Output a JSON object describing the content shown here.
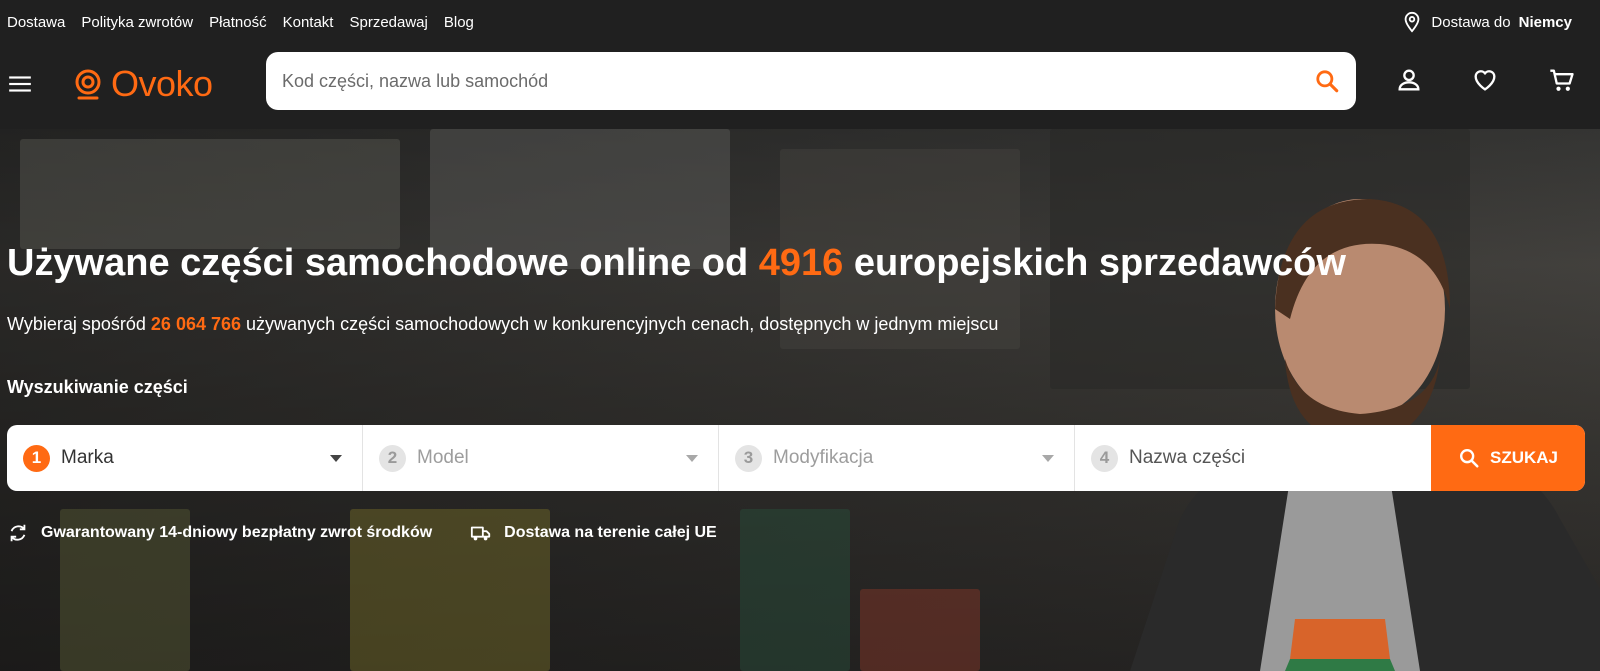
{
  "topbar": {
    "links": [
      "Dostawa",
      "Polityka zwrotów",
      "Płatność",
      "Kontakt",
      "Sprzedawaj",
      "Blog"
    ],
    "delivery_prefix": "Dostawa do",
    "delivery_country": "Niemcy"
  },
  "header": {
    "logo_text": "Ovoko",
    "search_placeholder": "Kod części, nazwa lub samochód"
  },
  "hero": {
    "title_part1": "Używane części samochodowe online od",
    "title_number": "4916",
    "title_part2": "europejskich sprzedawców",
    "sub_part1": "Wybieraj spośród",
    "sub_number": "26 064 766",
    "sub_part2": "używanych części samochodowych w konkurencyjnych cenach, dostępnych w jednym miejscu",
    "finder_label": "Wyszukiwanie części",
    "steps": [
      {
        "num": "1",
        "label": "Marka"
      },
      {
        "num": "2",
        "label": "Model"
      },
      {
        "num": "3",
        "label": "Modyfikacja"
      },
      {
        "num": "4",
        "label": "Nazwa części"
      }
    ],
    "search_button": "SZUKAJ",
    "perks": [
      "Gwarantowany 14-dniowy bezpłatny zwrot środków",
      "Dostawa na terenie całej UE"
    ]
  },
  "colors": {
    "accent": "#ff6a13",
    "topbar": "#202020"
  },
  "icons": [
    "menu-icon",
    "location-pin-icon",
    "search-icon",
    "user-icon",
    "heart-icon",
    "cart-icon",
    "refresh-icon",
    "truck-icon"
  ]
}
